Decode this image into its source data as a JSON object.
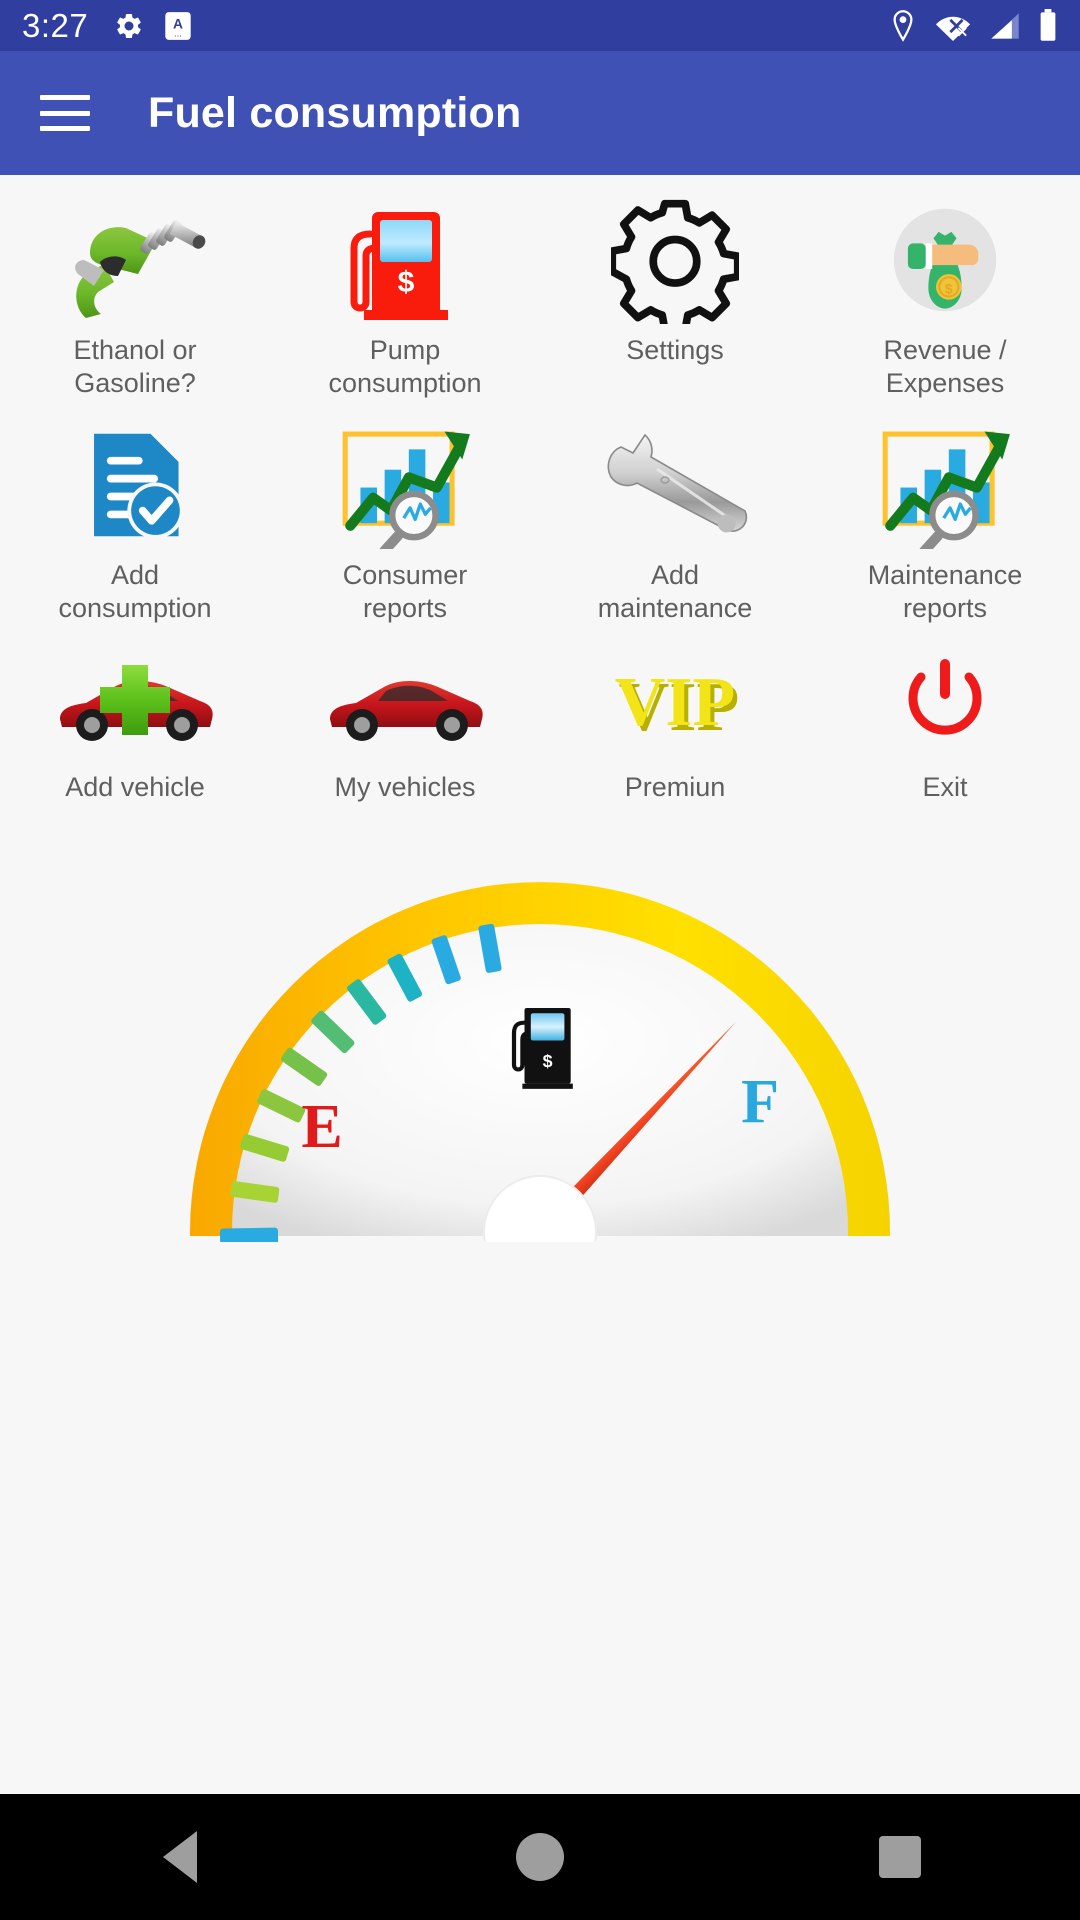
{
  "status_bar": {
    "time": "3:27",
    "left_icons": [
      "gear-icon",
      "android-auto-badge-icon"
    ],
    "right_icons": [
      "location-pin-icon",
      "wifi-off-icon",
      "cell-signal-icon",
      "battery-full-icon"
    ],
    "background_color": "#303f9f"
  },
  "app_bar": {
    "menu_icon": "hamburger-menu-icon",
    "title": "Fuel consumption",
    "background_color": "#3f51b5",
    "title_color": "#ffffff"
  },
  "grid": {
    "rows": [
      [
        {
          "label": "Ethanol or\nGasoline?",
          "icon": "fuel-nozzle-icon"
        },
        {
          "label": "Pump\nconsumption",
          "icon": "gas-pump-icon"
        },
        {
          "label": "Settings",
          "icon": "gear-outline-icon"
        },
        {
          "label": "Revenue /\nExpenses",
          "icon": "money-bag-hand-icon"
        }
      ],
      [
        {
          "label": "Add\nconsumption",
          "icon": "document-check-icon"
        },
        {
          "label": "Consumer\nreports",
          "icon": "bar-chart-magnifier-icon"
        },
        {
          "label": "Add\nmaintenance",
          "icon": "wrench-icon"
        },
        {
          "label": "Maintenance\nreports",
          "icon": "bar-chart-magnifier-icon"
        }
      ],
      [
        {
          "label": "Add vehicle",
          "icon": "car-plus-icon"
        },
        {
          "label": "My vehicles",
          "icon": "car-icon"
        },
        {
          "label": "Premiun",
          "icon": "vip-icon"
        },
        {
          "label": "Exit",
          "icon": "power-off-icon"
        }
      ]
    ],
    "label_color": "#5f5f5f",
    "background_color": "#f7f7f7"
  },
  "gauge": {
    "empty_label": "E",
    "full_label": "F",
    "center_icon": "gas-pump-icon",
    "ring_color": "#ffc800",
    "needle_color": "#e8442a",
    "empty_label_color": "#e01b1b",
    "full_label_color": "#29a8e0",
    "needle_position_percent": 74
  },
  "nav_bar": {
    "buttons": [
      "back-button",
      "home-button",
      "recents-button"
    ],
    "background_color": "#000000",
    "icon_color": "#9e9e9e"
  }
}
